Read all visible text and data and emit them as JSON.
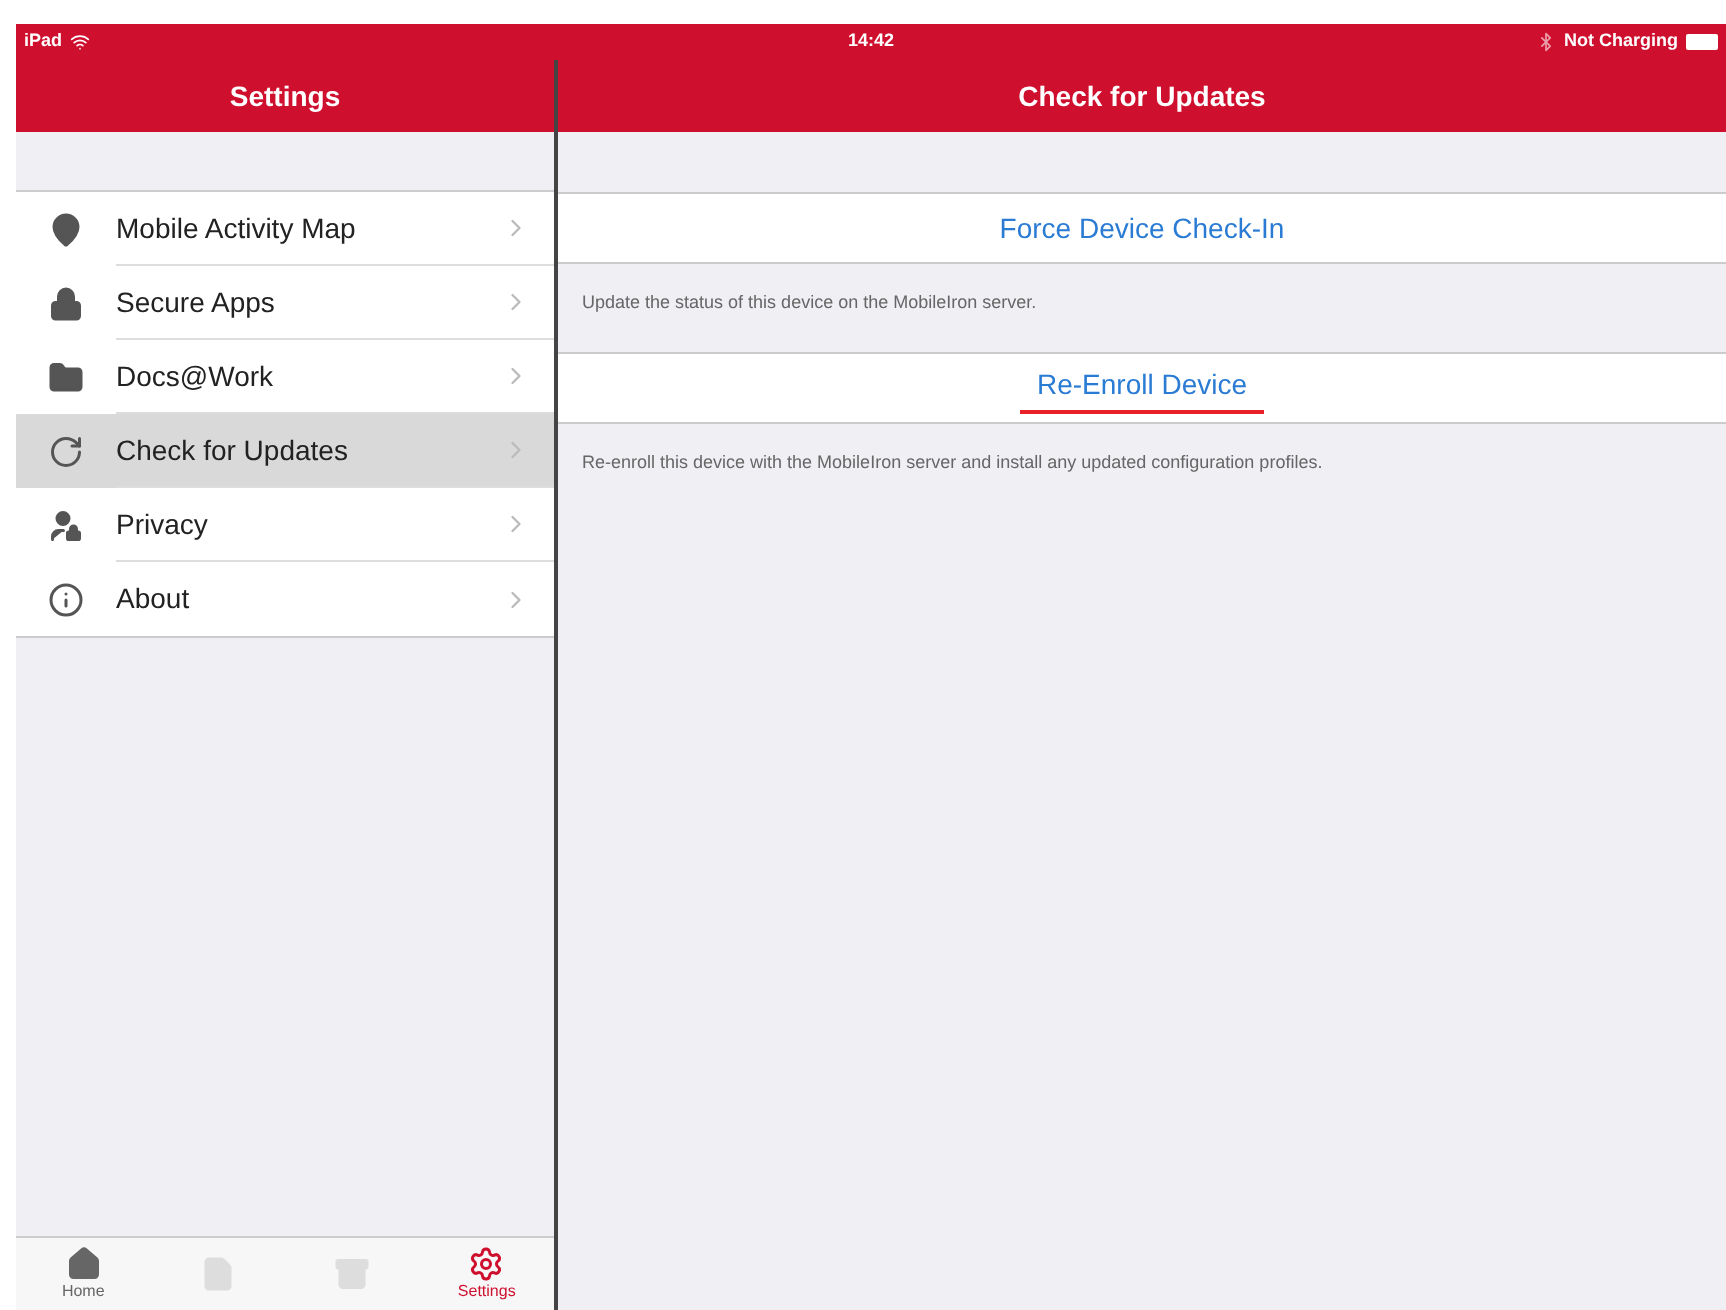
{
  "status_bar": {
    "device": "iPad",
    "time": "14:42",
    "charging": "Not Charging"
  },
  "sidebar": {
    "title": "Settings",
    "items": [
      {
        "label": "Mobile Activity Map",
        "selected": false
      },
      {
        "label": "Secure Apps",
        "selected": false
      },
      {
        "label": "Docs@Work",
        "selected": false
      },
      {
        "label": "Check for Updates",
        "selected": true
      },
      {
        "label": "Privacy",
        "selected": false
      },
      {
        "label": "About",
        "selected": false
      }
    ]
  },
  "detail": {
    "title": "Check for Updates",
    "actions": [
      {
        "label": "Force Device Check-In",
        "description": "Update the status of this device on the MobileIron server.",
        "marked": false
      },
      {
        "label": "Re-Enroll Device",
        "description": "Re-enroll this device with the MobileIron server and install any updated configuration profiles.",
        "marked": true
      }
    ]
  },
  "tab_bar": [
    {
      "label": "Home",
      "selected": false,
      "disabled": false
    },
    {
      "selected": false,
      "disabled": true
    },
    {
      "selected": false,
      "disabled": true
    },
    {
      "label": "Settings",
      "selected": true,
      "disabled": false
    }
  ]
}
